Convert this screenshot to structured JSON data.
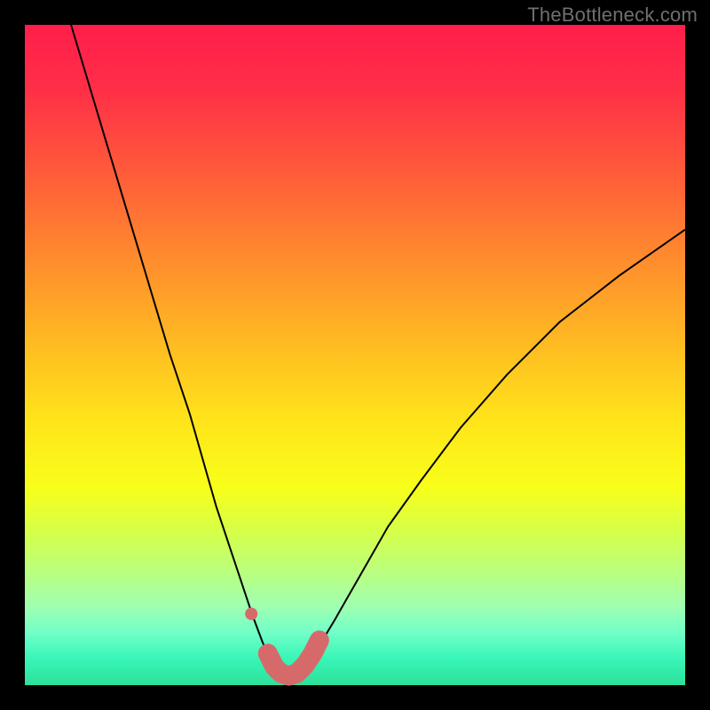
{
  "watermark": "TheBottleneck.com",
  "chart_data": {
    "type": "line",
    "title": "",
    "xlabel": "",
    "ylabel": "",
    "xlim": [
      0,
      100
    ],
    "ylim": [
      0,
      100
    ],
    "grid": false,
    "legend": false,
    "series": [
      {
        "name": "bottleneck-curve",
        "color": "#000000",
        "stroke_width": 2,
        "x": [
          7,
          10,
          13,
          16,
          19,
          22,
          25,
          27,
          29,
          31,
          33,
          34.5,
          36,
          37.2,
          38.0,
          38.6,
          39.2,
          40.0,
          40.8,
          42.0,
          44.0,
          47.0,
          51,
          55,
          60,
          66,
          73,
          81,
          90,
          100
        ],
        "values": [
          100,
          90,
          80,
          70,
          60,
          50,
          41,
          34,
          27,
          21,
          15,
          10.5,
          6.5,
          3.8,
          2.0,
          1.0,
          0.6,
          0.6,
          1.0,
          2.2,
          5.0,
          10.0,
          17,
          24,
          31,
          39,
          47,
          55,
          62,
          69
        ]
      }
    ],
    "markers": [
      {
        "name": "data-point-left",
        "shape": "circle",
        "color": "#d66a6a",
        "radius_px": 7,
        "x": 34.3,
        "y": 10.8
      }
    ],
    "segments": [
      {
        "name": "highlight-segment",
        "color": "#d66a6a",
        "stroke_width_px": 22,
        "linecap": "round",
        "points_x": [
          36.8,
          37.8,
          38.8,
          40.0,
          41.2,
          42.4,
          43.6,
          44.6
        ],
        "points_y": [
          4.8,
          2.8,
          1.8,
          1.4,
          1.8,
          3.0,
          4.8,
          6.8
        ]
      }
    ]
  }
}
